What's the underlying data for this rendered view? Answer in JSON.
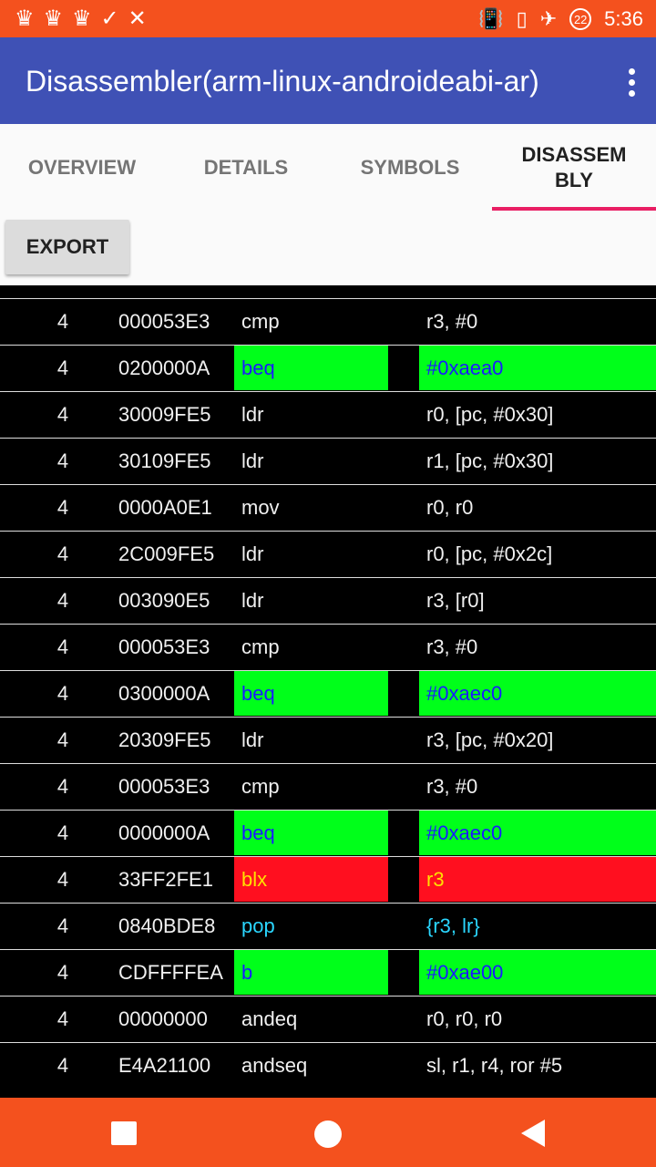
{
  "status_bar": {
    "time": "5:36",
    "battery_level": "22",
    "left_icons": [
      "crown-icon",
      "crown-icon",
      "crown-icon",
      "check-icon",
      "close-icon"
    ],
    "right_icons": [
      "vibrate-icon",
      "no-sim-icon",
      "airplane-icon",
      "battery-icon"
    ]
  },
  "app_bar": {
    "title": "Disassembler(arm-linux-androideabi-ar)"
  },
  "tabs": [
    {
      "label": "OVERVIEW"
    },
    {
      "label": "DETAILS"
    },
    {
      "label": "SYMBOLS"
    },
    {
      "label": "DISASSEM\nBLY"
    }
  ],
  "active_tab": 3,
  "toolbar": {
    "export_label": "EXPORT"
  },
  "colors": {
    "status_bar": "#f4511e",
    "app_bar": "#3f51b5",
    "tab_indicator": "#e91e63",
    "jump_bg": "#00ff1a",
    "call_bg": "#ff0f1f",
    "ret_text": "#2ad6ff"
  },
  "rows": [
    {
      "size": "4",
      "hex": "000053E3",
      "mnemonic": "cmp",
      "operands": "r3, #0",
      "kind": "normal"
    },
    {
      "size": "4",
      "hex": "0200000A",
      "mnemonic": "beq",
      "operands": "#0xaea0",
      "kind": "jmp"
    },
    {
      "size": "4",
      "hex": "30009FE5",
      "mnemonic": "ldr",
      "operands": "r0, [pc, #0x30]",
      "kind": "normal"
    },
    {
      "size": "4",
      "hex": "30109FE5",
      "mnemonic": "ldr",
      "operands": "r1, [pc, #0x30]",
      "kind": "normal"
    },
    {
      "size": "4",
      "hex": "0000A0E1",
      "mnemonic": "mov",
      "operands": "r0, r0",
      "kind": "normal"
    },
    {
      "size": "4",
      "hex": "2C009FE5",
      "mnemonic": "ldr",
      "operands": "r0, [pc, #0x2c]",
      "kind": "normal"
    },
    {
      "size": "4",
      "hex": "003090E5",
      "mnemonic": "ldr",
      "operands": "r3, [r0]",
      "kind": "normal"
    },
    {
      "size": "4",
      "hex": "000053E3",
      "mnemonic": "cmp",
      "operands": "r3, #0",
      "kind": "normal"
    },
    {
      "size": "4",
      "hex": "0300000A",
      "mnemonic": "beq",
      "operands": "#0xaec0",
      "kind": "jmp"
    },
    {
      "size": "4",
      "hex": "20309FE5",
      "mnemonic": "ldr",
      "operands": "r3, [pc, #0x20]",
      "kind": "normal"
    },
    {
      "size": "4",
      "hex": "000053E3",
      "mnemonic": "cmp",
      "operands": "r3, #0",
      "kind": "normal"
    },
    {
      "size": "4",
      "hex": "0000000A",
      "mnemonic": "beq",
      "operands": "#0xaec0",
      "kind": "jmp"
    },
    {
      "size": "4",
      "hex": "33FF2FE1",
      "mnemonic": "blx",
      "operands": "r3",
      "kind": "call"
    },
    {
      "size": "4",
      "hex": "0840BDE8",
      "mnemonic": "pop",
      "operands": "{r3, lr}",
      "kind": "ret"
    },
    {
      "size": "4",
      "hex": "CDFFFFEA",
      "mnemonic": "b",
      "operands": "#0xae00",
      "kind": "jmp"
    },
    {
      "size": "4",
      "hex": "00000000",
      "mnemonic": "andeq",
      "operands": "r0, r0, r0",
      "kind": "normal"
    },
    {
      "size": "4",
      "hex": "E4A21100",
      "mnemonic": "andseq",
      "operands": "sl, r1, r4, ror #5",
      "kind": "normal"
    }
  ]
}
